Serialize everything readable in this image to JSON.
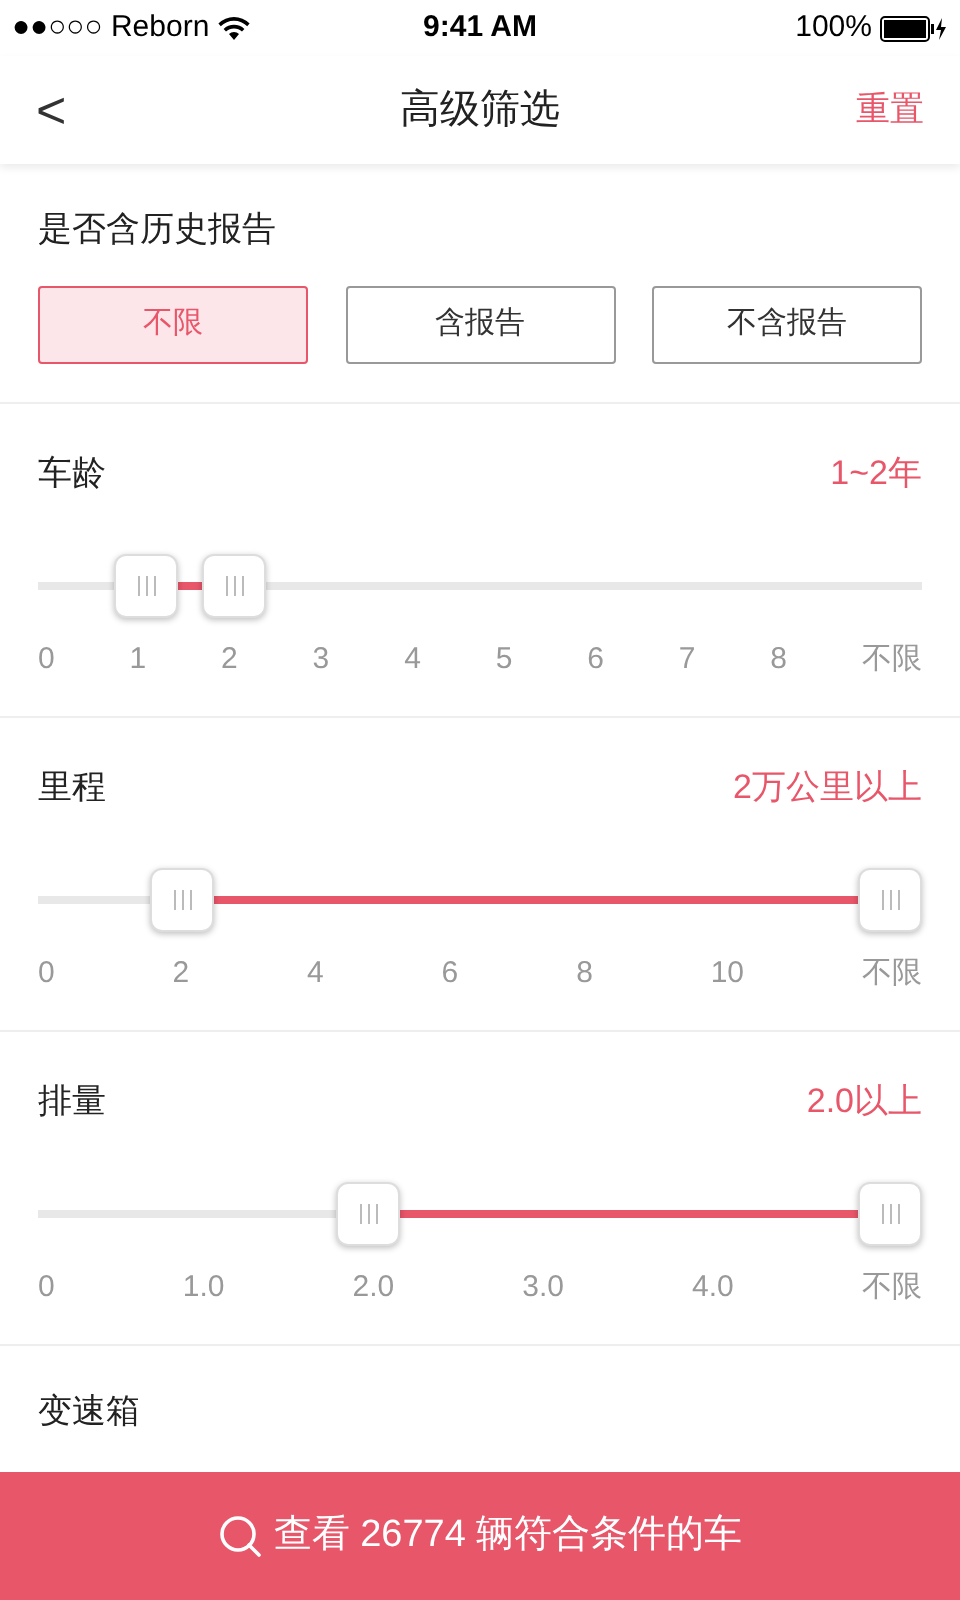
{
  "status_bar": {
    "carrier": "●●○○○ Reborn",
    "time": "9:41 AM",
    "battery": "100%"
  },
  "nav": {
    "back": "<",
    "title": "高级筛选",
    "reset": "重置"
  },
  "history_report": {
    "title": "是否含历史报告",
    "options": [
      {
        "label": "不限",
        "selected": true
      },
      {
        "label": "含报告",
        "selected": false
      },
      {
        "label": "不含报告",
        "selected": false
      }
    ]
  },
  "sliders": [
    {
      "title": "车龄",
      "value": "1~2年",
      "ticks": [
        "0",
        "1",
        "2",
        "3",
        "4",
        "5",
        "6",
        "7",
        "8",
        "不限"
      ]
    },
    {
      "title": "里程",
      "value": "2万公里以上",
      "ticks": [
        "0",
        "2",
        "4",
        "6",
        "8",
        "10",
        "不限"
      ]
    },
    {
      "title": "排量",
      "value": "2.0以上",
      "ticks": [
        "0",
        "1.0",
        "2.0",
        "3.0",
        "4.0",
        "不限"
      ]
    }
  ],
  "next_section": {
    "title": "变速箱"
  },
  "bottom_button": {
    "label": "查看 26774 辆符合条件的车"
  }
}
